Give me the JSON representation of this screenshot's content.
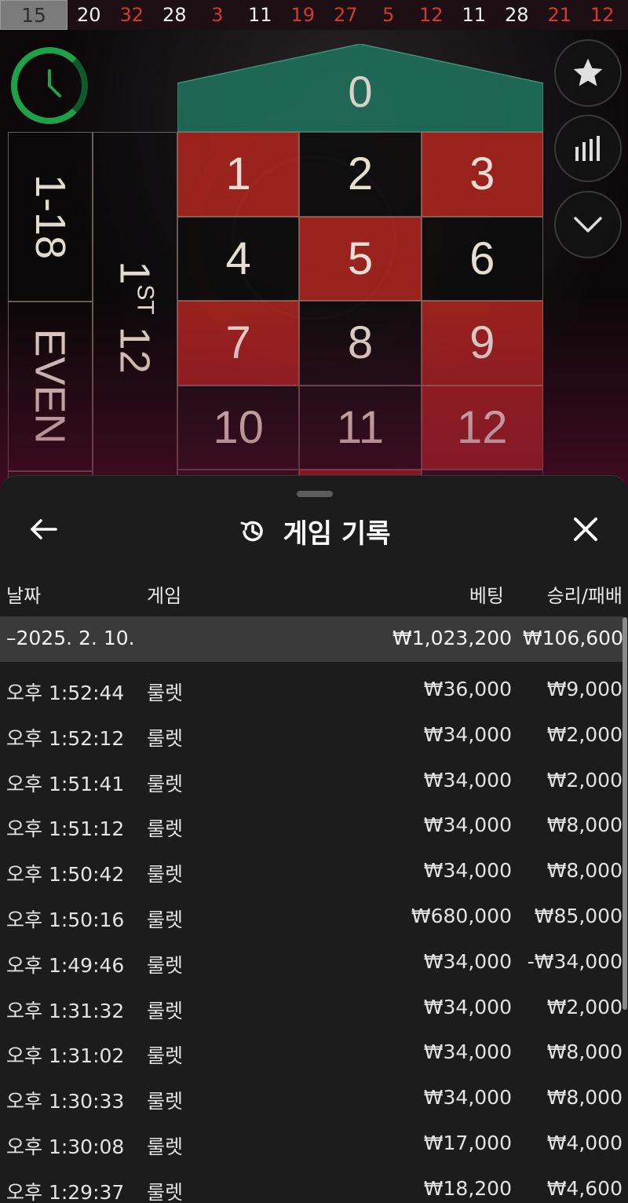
{
  "history": [
    {
      "value": "15",
      "color": "black",
      "latest": true
    },
    {
      "value": "20",
      "color": "black"
    },
    {
      "value": "32",
      "color": "red"
    },
    {
      "value": "28",
      "color": "black"
    },
    {
      "value": "3",
      "color": "red"
    },
    {
      "value": "11",
      "color": "black"
    },
    {
      "value": "19",
      "color": "red"
    },
    {
      "value": "27",
      "color": "red"
    },
    {
      "value": "5",
      "color": "red"
    },
    {
      "value": "12",
      "color": "red"
    },
    {
      "value": "11",
      "color": "black"
    },
    {
      "value": "28",
      "color": "black"
    },
    {
      "value": "21",
      "color": "red"
    },
    {
      "value": "12",
      "color": "red"
    }
  ],
  "table": {
    "zero": "0",
    "numbers": [
      {
        "n": "1",
        "color": "red"
      },
      {
        "n": "2",
        "color": "black"
      },
      {
        "n": "3",
        "color": "red"
      },
      {
        "n": "4",
        "color": "black"
      },
      {
        "n": "5",
        "color": "red"
      },
      {
        "n": "6",
        "color": "black"
      },
      {
        "n": "7",
        "color": "red"
      },
      {
        "n": "8",
        "color": "black"
      },
      {
        "n": "9",
        "color": "red"
      },
      {
        "n": "10",
        "color": "black"
      },
      {
        "n": "11",
        "color": "black"
      },
      {
        "n": "12",
        "color": "red"
      }
    ],
    "low_bet": "1-18",
    "even_bet": "EVEN",
    "dozen_num": "1",
    "dozen_sup": "ST",
    "dozen_label": "12"
  },
  "colors": {
    "red": "#ac241e",
    "black": "#0e0c0c",
    "zero_green": "#1f6e5a",
    "timer_green": "#1fa14a",
    "sheet_bg": "#1c1c1c",
    "date_row_bg": "#3a3a3a"
  },
  "icons": {
    "timer": "clock-icon",
    "favorites": "star-icon",
    "statistics": "bar-chart-icon",
    "collapse": "chevron-down-icon",
    "back": "arrow-left-icon",
    "title": "history-icon",
    "close": "close-icon"
  },
  "sheet": {
    "title": "게임 기록",
    "columns": {
      "date": "날짜",
      "game": "게임",
      "bet": "베팅",
      "result": "승리/패배"
    },
    "date_group": {
      "label": "–2025. 2. 10.",
      "bet_total": "₩1,023,200",
      "result_total": "₩106,600"
    },
    "rows": [
      {
        "time": "오후 1:52:44",
        "game": "룰렛",
        "bet": "₩36,000",
        "result": "₩9,000"
      },
      {
        "time": "오후 1:52:12",
        "game": "룰렛",
        "bet": "₩34,000",
        "result": "₩2,000"
      },
      {
        "time": "오후 1:51:41",
        "game": "룰렛",
        "bet": "₩34,000",
        "result": "₩2,000"
      },
      {
        "time": "오후 1:51:12",
        "game": "룰렛",
        "bet": "₩34,000",
        "result": "₩8,000"
      },
      {
        "time": "오후 1:50:42",
        "game": "룰렛",
        "bet": "₩34,000",
        "result": "₩8,000"
      },
      {
        "time": "오후 1:50:16",
        "game": "룰렛",
        "bet": "₩680,000",
        "result": "₩85,000"
      },
      {
        "time": "오후 1:49:46",
        "game": "룰렛",
        "bet": "₩34,000",
        "result": "-₩34,000"
      },
      {
        "time": "오후 1:31:32",
        "game": "룰렛",
        "bet": "₩34,000",
        "result": "₩2,000"
      },
      {
        "time": "오후 1:31:02",
        "game": "룰렛",
        "bet": "₩34,000",
        "result": "₩8,000"
      },
      {
        "time": "오후 1:30:33",
        "game": "룰렛",
        "bet": "₩34,000",
        "result": "₩8,000"
      },
      {
        "time": "오후 1:30:08",
        "game": "룰렛",
        "bet": "₩17,000",
        "result": "₩4,000"
      },
      {
        "time": "오후 1:29:37",
        "game": "룰렛",
        "bet": "₩18,200",
        "result": "₩4,600"
      }
    ]
  }
}
